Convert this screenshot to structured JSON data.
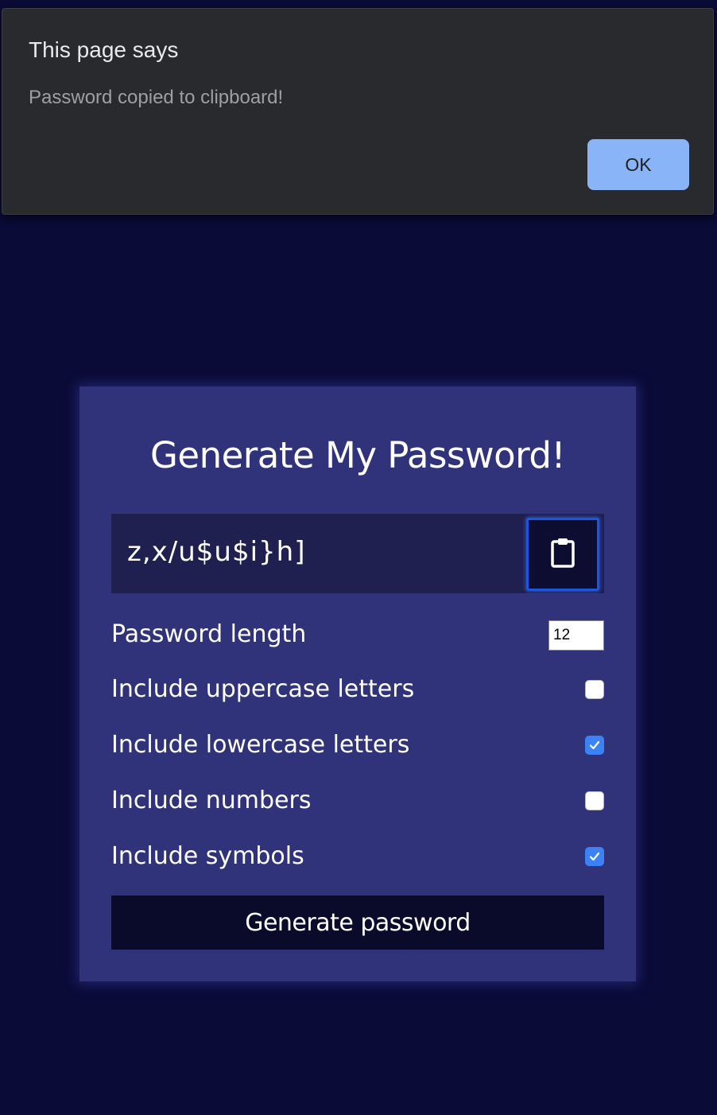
{
  "dialog": {
    "title": "This page says",
    "message": "Password copied to clipboard!",
    "ok_label": "OK"
  },
  "generator": {
    "title": "Generate My Password!",
    "result": "z,x/u$u$i}h]",
    "clipboard_icon": "clipboard-icon",
    "settings": [
      {
        "label": "Password length",
        "type": "number",
        "value": "12"
      },
      {
        "label": "Include uppercase letters",
        "type": "checkbox",
        "checked": false
      },
      {
        "label": "Include lowercase letters",
        "type": "checkbox",
        "checked": true
      },
      {
        "label": "Include numbers",
        "type": "checkbox",
        "checked": false
      },
      {
        "label": "Include symbols",
        "type": "checkbox",
        "checked": true
      }
    ],
    "generate_label": "Generate password"
  },
  "colors": {
    "page_background": "#0a0b37",
    "card_background": "#31337a",
    "result_background": "#1f2050",
    "button_background": "#0a0b2b",
    "dialog_background": "#292a2d",
    "dialog_button": "#8ab4f8",
    "checkbox_checked": "#3b82f6"
  }
}
